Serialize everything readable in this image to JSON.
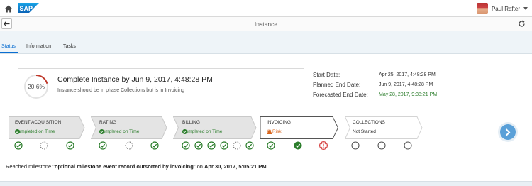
{
  "shell": {
    "logo": "SAP",
    "user_name": "Paul Rafter"
  },
  "titlebar": {
    "title": "Instance"
  },
  "tabs": [
    {
      "label": "Status",
      "active": true
    },
    {
      "label": "Information",
      "active": false
    },
    {
      "label": "Tasks",
      "active": false
    }
  ],
  "summary": {
    "progress_percent": "20.6%",
    "progress_value": 20.6,
    "title": "Complete Instance by Jun 9, 2017, 4:48:28 PM",
    "subtitle": "Instance should be in phase Collections but is in Invoicing"
  },
  "dates": [
    {
      "label": "Start Date:",
      "value": "Apr 25, 2017, 4:48:28 PM",
      "color": "#333333"
    },
    {
      "label": "Planned End Date:",
      "value": "Jun 9, 2017, 4:48:28 PM",
      "color": "#333333"
    },
    {
      "label": "Forecasted End Date:",
      "value": "May 28, 2017, 9:38:21 PM",
      "color": "#2b7d2b"
    }
  ],
  "phases": [
    {
      "name": "EVENT ACQUISITION",
      "status": "Completed on Time",
      "state": "completed",
      "milestones": [
        "done",
        "pending",
        "done"
      ]
    },
    {
      "name": "RATING",
      "status": "Completed on Time",
      "state": "completed",
      "milestones": [
        "done",
        "pending",
        "done"
      ]
    },
    {
      "name": "BILLING",
      "status": "Completed on Time",
      "state": "completed",
      "milestones": [
        "done",
        "done",
        "done",
        "done",
        "pending",
        "done"
      ]
    },
    {
      "name": "INVOICING",
      "status": "At Risk",
      "state": "active",
      "milestones": [
        "done",
        "done-current",
        "error"
      ]
    },
    {
      "name": "COLLECTIONS",
      "status": "Not Started",
      "state": "future",
      "milestones": [
        "empty",
        "empty",
        "empty"
      ]
    }
  ],
  "colors": {
    "success": "#2b7d2b",
    "risk": "#d9671f",
    "error": "#d12b2b",
    "accent": "#0a6ed1",
    "ring": "#c0392b"
  },
  "footer": {
    "prefix": "Reached milestone \"",
    "milestone": "optional milestone event record outsorted by invoicing",
    "middle": "\" on ",
    "date": "Apr 30, 2017, 5:05:21 PM"
  }
}
